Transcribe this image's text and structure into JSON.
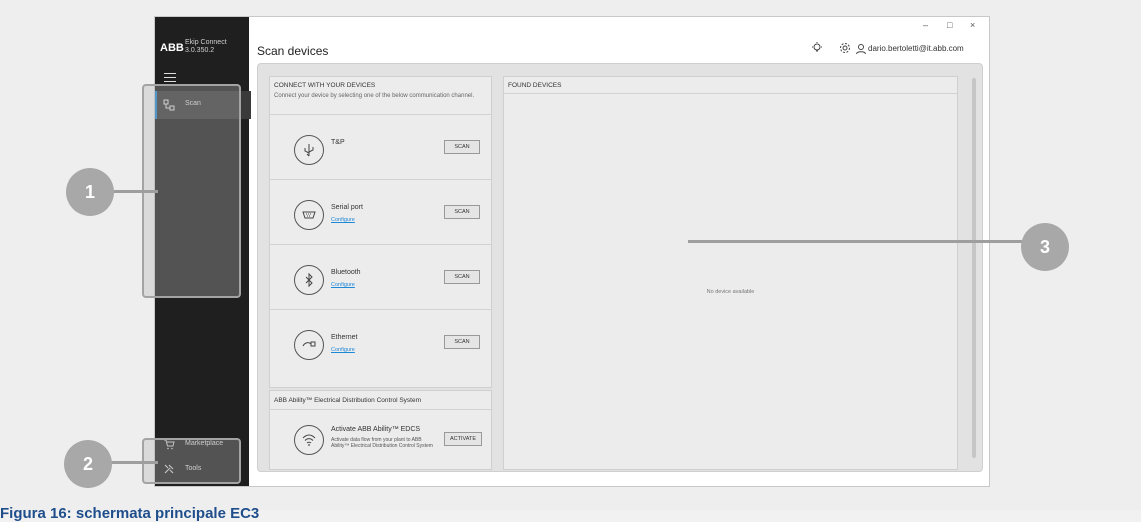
{
  "app": {
    "brand": "ABB",
    "name": "Ekip Connect",
    "version": "3.0.350.2",
    "page_title": "Scan devices",
    "user": "dario.bertoletti@it.abb.com",
    "window_controls": {
      "minimize": "–",
      "maximize": "□",
      "close": "×"
    }
  },
  "sidebar": {
    "items": [
      {
        "label": "Scan",
        "icon": "scan-icon",
        "active": true
      },
      {
        "label": "Marketplace",
        "icon": "cart-icon"
      },
      {
        "label": "Tools",
        "icon": "tools-icon"
      }
    ]
  },
  "connect": {
    "title": "CONNECT WITH YOUR DEVICES",
    "description": "Connect your device by selecting one of the below communication channel.",
    "channels": [
      {
        "name": "T&P",
        "button": "SCAN",
        "configure": "",
        "icon": "usb-icon"
      },
      {
        "name": "Serial port",
        "button": "SCAN",
        "configure": "Configure",
        "icon": "serial-port-icon"
      },
      {
        "name": "Bluetooth",
        "button": "SCAN",
        "configure": "Configure",
        "icon": "bluetooth-icon"
      },
      {
        "name": "Ethernet",
        "button": "SCAN",
        "configure": "Configure",
        "icon": "ethernet-icon"
      }
    ]
  },
  "edcs": {
    "title": "ABB Ability™ Electrical Distribution Control System",
    "name": "Activate ABB Ability™ EDCS",
    "description": "Activate data flow from your plant to ABB Ability™ Electrical Distribution Control System",
    "button": "ACTIVATE",
    "icon": "wifi-icon"
  },
  "found": {
    "title": "FOUND DEVICES",
    "empty": "No device available"
  },
  "callouts": [
    "1",
    "2",
    "3"
  ],
  "caption": "Figura 16: schermata principale EC3",
  "colors": {
    "accent": "#1e87d6",
    "sidebar": "#1f1f1f",
    "callout": "#a8a8a8",
    "caption": "#1f4e8c"
  }
}
